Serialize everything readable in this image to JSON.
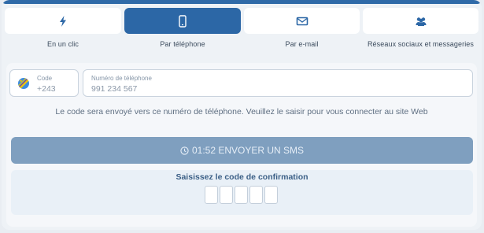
{
  "tabs": [
    {
      "label": "En un clic",
      "icon": "lightning-icon"
    },
    {
      "label": "Par téléphone",
      "icon": "phone-icon"
    },
    {
      "label": "Par e-mail",
      "icon": "envelope-icon"
    },
    {
      "label": "Réseaux sociaux et messageries",
      "icon": "users-icon"
    }
  ],
  "active_tab": 1,
  "country_code": {
    "label": "Code",
    "value": "+243"
  },
  "phone": {
    "label": "Numéro de téléphone",
    "placeholder": "991 234 567"
  },
  "hint": "Le code sera envoyé vers ce numéro de téléphone. Veuillez le saisir pour vous connecter au site Web",
  "sms_button": {
    "timer": "01:52",
    "label": "ENVOYER UN SMS"
  },
  "confirmation": {
    "title": "Saisissez le code de confirmation",
    "box_count": 5
  },
  "colors": {
    "accent": "#2c67a6",
    "button_disabled": "#7f9fbf",
    "background": "#eef2f6"
  }
}
